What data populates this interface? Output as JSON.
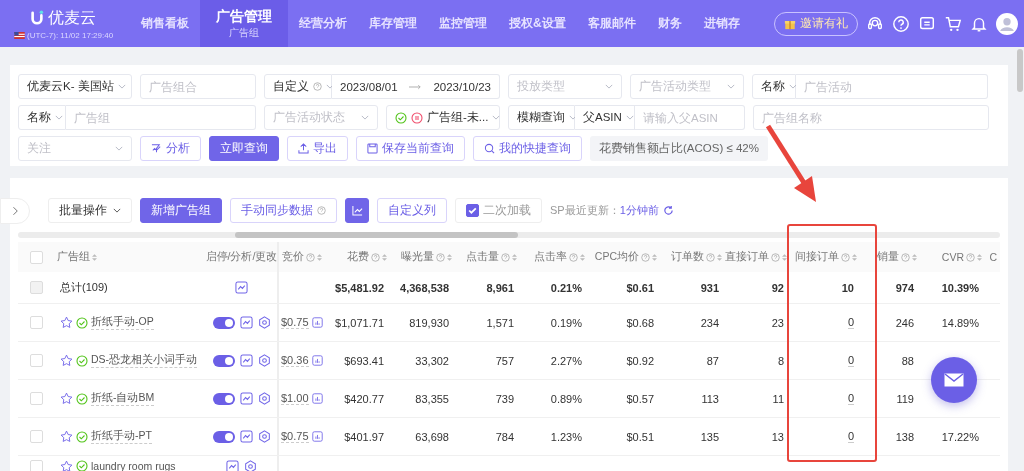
{
  "header": {
    "logo": "优麦云",
    "timezone": "(UTC-7): 11/02 17:29:40",
    "nav": [
      {
        "label": "销售看板",
        "selected": false
      },
      {
        "label": "广告管理",
        "selected": true,
        "sub": "广告组"
      },
      {
        "label": "经营分析",
        "selected": false
      },
      {
        "label": "库存管理",
        "selected": false
      },
      {
        "label": "监控管理",
        "selected": false
      },
      {
        "label": "授权&设置",
        "selected": false
      },
      {
        "label": "客服邮件",
        "selected": false
      },
      {
        "label": "财务",
        "selected": false
      },
      {
        "label": "进销存",
        "selected": false
      }
    ],
    "invite": "邀请有礼"
  },
  "filters": {
    "shop": {
      "value": "优麦云K- 美国站"
    },
    "portfolio": {
      "placeholder": "广告组合"
    },
    "date_mode": {
      "value": "自定义"
    },
    "date_from": "2023/08/01",
    "date_to": "2023/10/23",
    "targeting_type": {
      "placeholder": "投放类型"
    },
    "campaign_type": {
      "placeholder": "广告活动类型"
    },
    "campaign_field": {
      "value": "名称"
    },
    "campaign_search": {
      "placeholder": "广告活动"
    },
    "group_field": {
      "value": "名称"
    },
    "group_search": {
      "placeholder": "广告组"
    },
    "campaign_status": {
      "placeholder": "广告活动状态"
    },
    "group_status": {
      "value": "广告组-未..."
    },
    "match_mode": {
      "value": "模糊查询"
    },
    "asin_field": {
      "value": "父ASIN"
    },
    "asin_search": {
      "placeholder": "请输入父ASIN"
    },
    "group_name": {
      "placeholder": "广告组名称"
    },
    "follow": {
      "placeholder": "关注"
    },
    "buttons": [
      {
        "label": "分析",
        "kind": "analyze"
      },
      {
        "label": "立即查询",
        "kind": "primary"
      },
      {
        "label": "导出",
        "kind": "export"
      },
      {
        "label": "保存当前查询",
        "kind": "save"
      },
      {
        "label": "我的快捷查询",
        "kind": "search"
      }
    ],
    "condition_tag": "花费销售额占比(ACOS) ≤ 42%"
  },
  "toolbar": {
    "batch": "批量操作",
    "add": "新增广告组",
    "sync": "手动同步数据",
    "custom_columns": "自定义列",
    "second_load": {
      "label": "二次加载",
      "checked": true
    },
    "update_label": "SP最近更新：",
    "update_time": "1分钟前"
  },
  "table": {
    "select_all": {
      "checked": false
    },
    "columns": [
      {
        "label": "广告组",
        "help": false,
        "sortable": true
      },
      {
        "label": "启停/分析/更改",
        "help": false,
        "sortable": false
      },
      {
        "label": "竞价",
        "help": true,
        "sortable": true
      },
      {
        "label": "花费",
        "help": true,
        "sortable": true
      },
      {
        "label": "曝光量",
        "help": true,
        "sortable": true
      },
      {
        "label": "点击量",
        "help": true,
        "sortable": true
      },
      {
        "label": "点击率",
        "help": true,
        "sortable": true
      },
      {
        "label": "CPC均价",
        "help": true,
        "sortable": true
      },
      {
        "label": "订单数",
        "help": true,
        "sortable": true
      },
      {
        "label": "直接订单",
        "help": true,
        "sortable": true
      },
      {
        "label": "间接订单",
        "help": true,
        "sortable": true
      },
      {
        "label": "销量",
        "help": true,
        "sortable": true
      },
      {
        "label": "CVR",
        "help": true,
        "sortable": true
      },
      {
        "label": "C",
        "help": false,
        "sortable": false
      }
    ],
    "total": {
      "label": "总计(109)",
      "checked": false,
      "disabled": true,
      "cells": [
        "$5,481.92",
        "4,368,538",
        "8,961",
        "0.21%",
        "$0.61",
        "931",
        "92",
        "10",
        "974",
        "10.39%"
      ]
    },
    "rows": [
      {
        "name": "折纸手动-OP",
        "checked": false,
        "starred": false,
        "on": true,
        "bid": "$0.75",
        "cells": [
          "$1,071.71",
          "819,930",
          "1,571",
          "0.19%",
          "$0.68",
          "234",
          "23",
          "0",
          "246",
          "14.89%"
        ]
      },
      {
        "name": "DS-恐龙相关小词手动",
        "checked": false,
        "starred": false,
        "on": true,
        "bid": "$0.36",
        "cells": [
          "$693.41",
          "33,302",
          "757",
          "2.27%",
          "$0.92",
          "87",
          "8",
          "0",
          "88",
          null
        ]
      },
      {
        "name": "折纸-自动BM",
        "checked": false,
        "starred": false,
        "on": true,
        "bid": "$1.00",
        "cells": [
          "$420.77",
          "83,355",
          "739",
          "0.89%",
          "$0.57",
          "113",
          "11",
          "0",
          "119",
          null
        ]
      },
      {
        "name": "折纸手动-PT",
        "checked": false,
        "starred": false,
        "on": true,
        "bid": "$0.75",
        "cells": [
          "$401.97",
          "63,698",
          "784",
          "1.23%",
          "$0.51",
          "135",
          "13",
          "0",
          "138",
          "17.22%"
        ]
      },
      {
        "name": "laundry room rugs",
        "checked": false,
        "starred": false
      }
    ]
  }
}
